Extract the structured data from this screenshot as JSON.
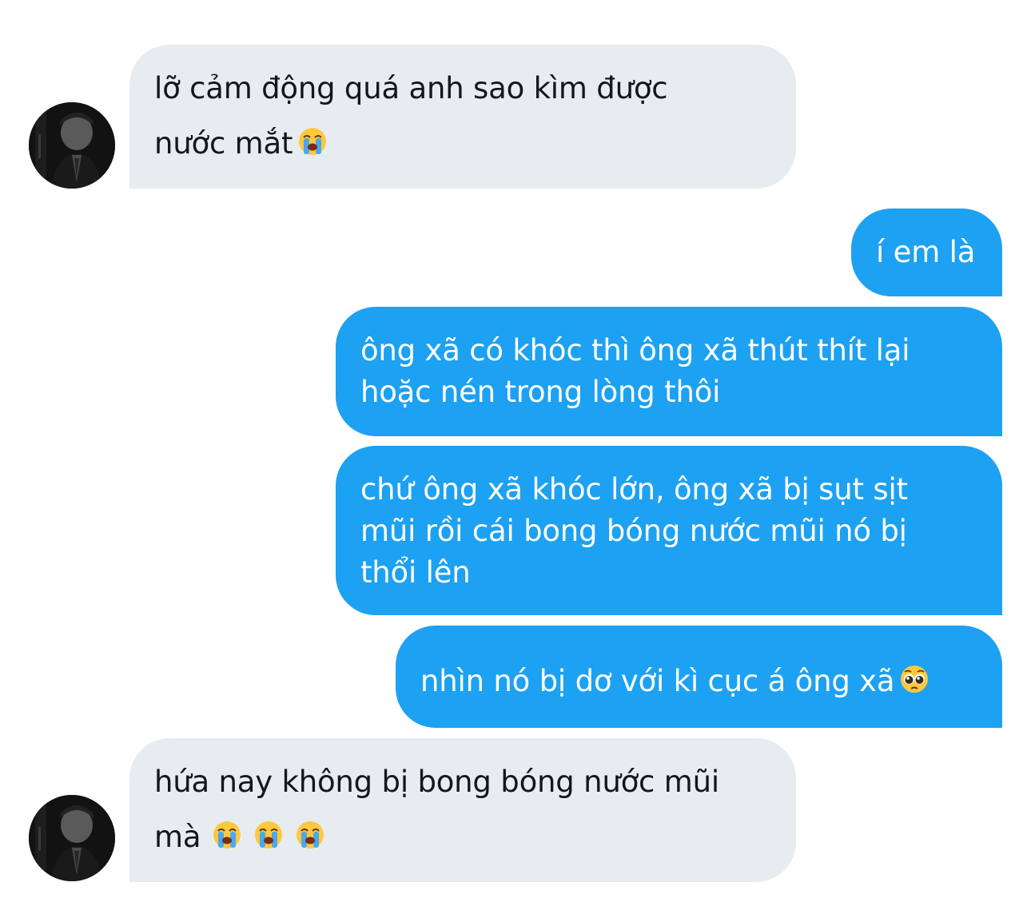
{
  "conversation": {
    "messages": [
      {
        "direction": "received",
        "lines": [
          "lỡ cảm động quá anh sao kìm được",
          "nước mắt"
        ],
        "emojis": [
          "loudly-crying-face"
        ]
      },
      {
        "direction": "sent",
        "lines": [
          "í em là"
        ]
      },
      {
        "direction": "sent",
        "lines": [
          "ông xã có khóc thì ông xã thút thít lại",
          "hoặc nén trong lòng thôi"
        ]
      },
      {
        "direction": "sent",
        "lines": [
          "chứ ông xã khóc lớn, ông xã bị sụt sịt",
          "mũi rồi cái bong bóng nước mũi nó bị",
          "thổi lên"
        ]
      },
      {
        "direction": "sent",
        "lines": [
          "nhìn nó bị dơ với kì cục á ông xã"
        ],
        "emojis": [
          "pleading-face"
        ]
      },
      {
        "direction": "received",
        "lines": [
          "hứa nay không bị bong bóng nước mũi",
          "mà"
        ],
        "emojis": [
          "loudly-crying-face",
          "loudly-crying-face",
          "loudly-crying-face"
        ]
      }
    ]
  },
  "colors": {
    "received_bubble": "#e7ecf0",
    "received_text": "#14171a",
    "sent_bubble": "#1da1f2",
    "sent_text": "#ffffff",
    "background": "#ffffff"
  }
}
